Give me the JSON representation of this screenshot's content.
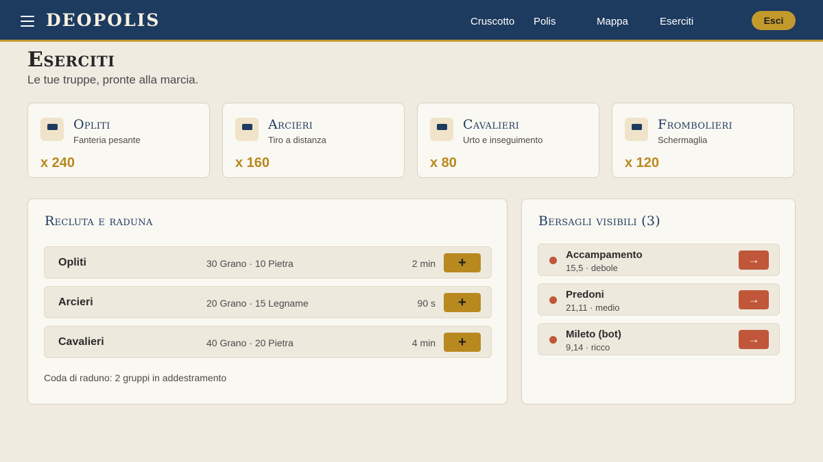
{
  "header": {
    "brand": "DEOPOLIS",
    "menu_icon": "hamburger-menu-icon",
    "nav": [
      "Cruscotto",
      "Polis",
      "Mappa",
      "Eserciti"
    ],
    "logout_label": "Esci"
  },
  "page": {
    "title": "Eserciti",
    "subtitle": "Le tue truppe, pronte alla marcia."
  },
  "units": [
    {
      "name": "Opliti",
      "desc": "Fanteria pesante",
      "count": "x 240",
      "icon": "unit-icon"
    },
    {
      "name": "Arcieri",
      "desc": "Tiro a distanza",
      "count": "x 160",
      "icon": "unit-icon"
    },
    {
      "name": "Cavalieri",
      "desc": "Urto e inseguimento",
      "count": "x 80",
      "icon": "unit-icon"
    },
    {
      "name": "Frombolieri",
      "desc": "Schermaglia",
      "count": "x 120",
      "icon": "unit-icon"
    }
  ],
  "recruit": {
    "title": "Recluta e raduna",
    "rows": [
      {
        "name": "Opliti",
        "cost": "30 Grano · 10 Pietra",
        "time": "2 min",
        "button": "+"
      },
      {
        "name": "Arcieri",
        "cost": "20 Grano · 15 Legname",
        "time": "90 s",
        "button": "+"
      },
      {
        "name": "Cavalieri",
        "cost": "40 Grano · 20 Pietra",
        "time": "4 min",
        "button": "+"
      }
    ],
    "queue_note": "Coda di raduno: 2 gruppi in addestramento"
  },
  "targets": {
    "title": "Bersagli visibili (3)",
    "rows": [
      {
        "name": "Accampamento",
        "meta": "15,5 · debole",
        "button": "→"
      },
      {
        "name": "Predoni",
        "meta": "21,11 · medio",
        "button": "→"
      },
      {
        "name": "Mileto (bot)",
        "meta": "9,14 · ricco",
        "button": "→"
      }
    ]
  },
  "colors": {
    "navy": "#1d3a5f",
    "gold": "#c29a2c",
    "accent_red": "#c0573a",
    "background": "#efebe1",
    "card": "#faf8f2"
  }
}
